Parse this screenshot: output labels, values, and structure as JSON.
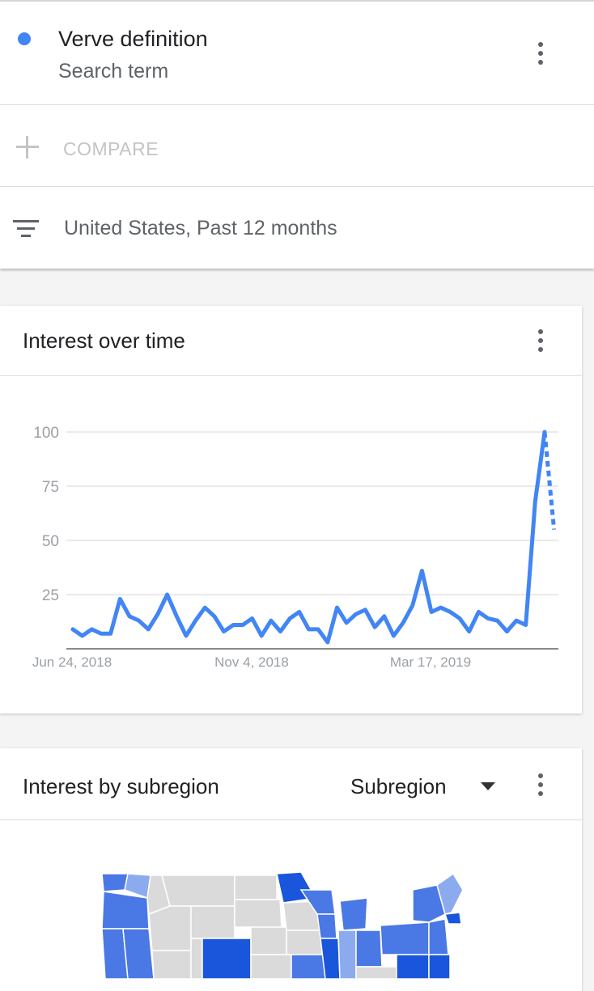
{
  "search_term": {
    "title": "Verve definition",
    "subtitle": "Search term",
    "color": "#4285f4"
  },
  "compare": {
    "label": "COMPARE"
  },
  "filter": {
    "label": "United States, Past 12 months"
  },
  "interest_over_time": {
    "title": "Interest over time"
  },
  "interest_by_subregion": {
    "title": "Interest by subregion",
    "dropdown_value": "Subregion"
  },
  "chart_data": {
    "type": "line",
    "title": "Interest over time",
    "xlabel": "",
    "ylabel": "",
    "ylim": [
      0,
      100
    ],
    "y_ticks": [
      "25",
      "50",
      "75",
      "100"
    ],
    "x_tick_labels": [
      "Jun 24, 2018",
      "Nov 4, 2018",
      "Mar 17, 2019"
    ],
    "grid": true,
    "series": [
      {
        "color": "#4285f4",
        "values": [
          9,
          6,
          9,
          7,
          7,
          23,
          15,
          13,
          9,
          16,
          25,
          15,
          6,
          13,
          19,
          15,
          8,
          11,
          11,
          14,
          6,
          13,
          8,
          14,
          17,
          9,
          9,
          3,
          19,
          12,
          16,
          18,
          10,
          15,
          6,
          12,
          20,
          36,
          17,
          19,
          17,
          14,
          8,
          17,
          14,
          13,
          8,
          13,
          11,
          68,
          100
        ],
        "partial_values": [
          100,
          55
        ]
      }
    ]
  },
  "map": {
    "colors": {
      "dark": "#1a56db",
      "mid": "#4a78e4",
      "light": "#8cabef",
      "none": "#dadada"
    }
  }
}
